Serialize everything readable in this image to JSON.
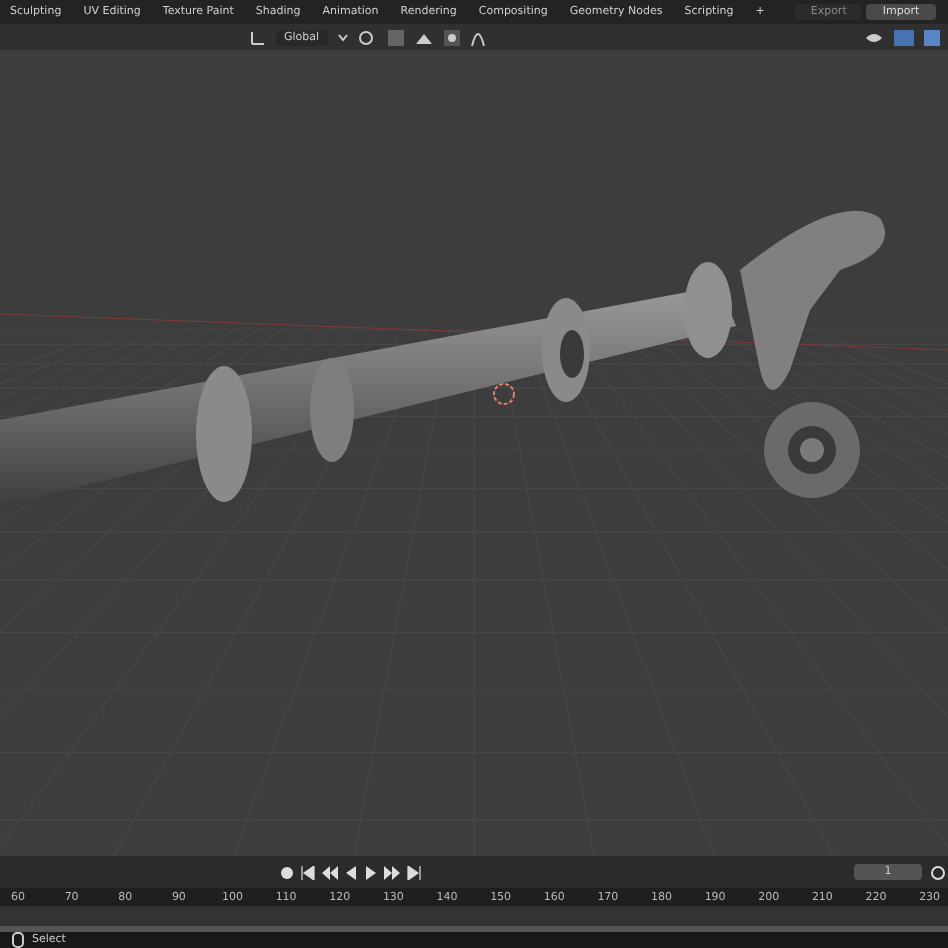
{
  "workspace_tabs": [
    {
      "label": "Sculpting",
      "selected": false
    },
    {
      "label": "UV Editing",
      "selected": false
    },
    {
      "label": "Texture Paint",
      "selected": false
    },
    {
      "label": "Shading",
      "selected": false
    },
    {
      "label": "Animation",
      "selected": false
    },
    {
      "label": "Rendering",
      "selected": false
    },
    {
      "label": "Compositing",
      "selected": false
    },
    {
      "label": "Geometry Nodes",
      "selected": false
    },
    {
      "label": "Scripting",
      "selected": false
    }
  ],
  "add_tab": "+",
  "file_buttons": [
    {
      "label": "Export",
      "selected": false
    },
    {
      "label": "Import",
      "selected": true
    }
  ],
  "header": {
    "orientation": "Global"
  },
  "timeline": {
    "current_frame": "1",
    "ticks": [
      "60",
      "70",
      "80",
      "90",
      "100",
      "110",
      "120",
      "130",
      "140",
      "150",
      "160",
      "170",
      "180",
      "190",
      "200",
      "210",
      "220",
      "230"
    ]
  },
  "status_bar": {
    "action": "Select"
  }
}
